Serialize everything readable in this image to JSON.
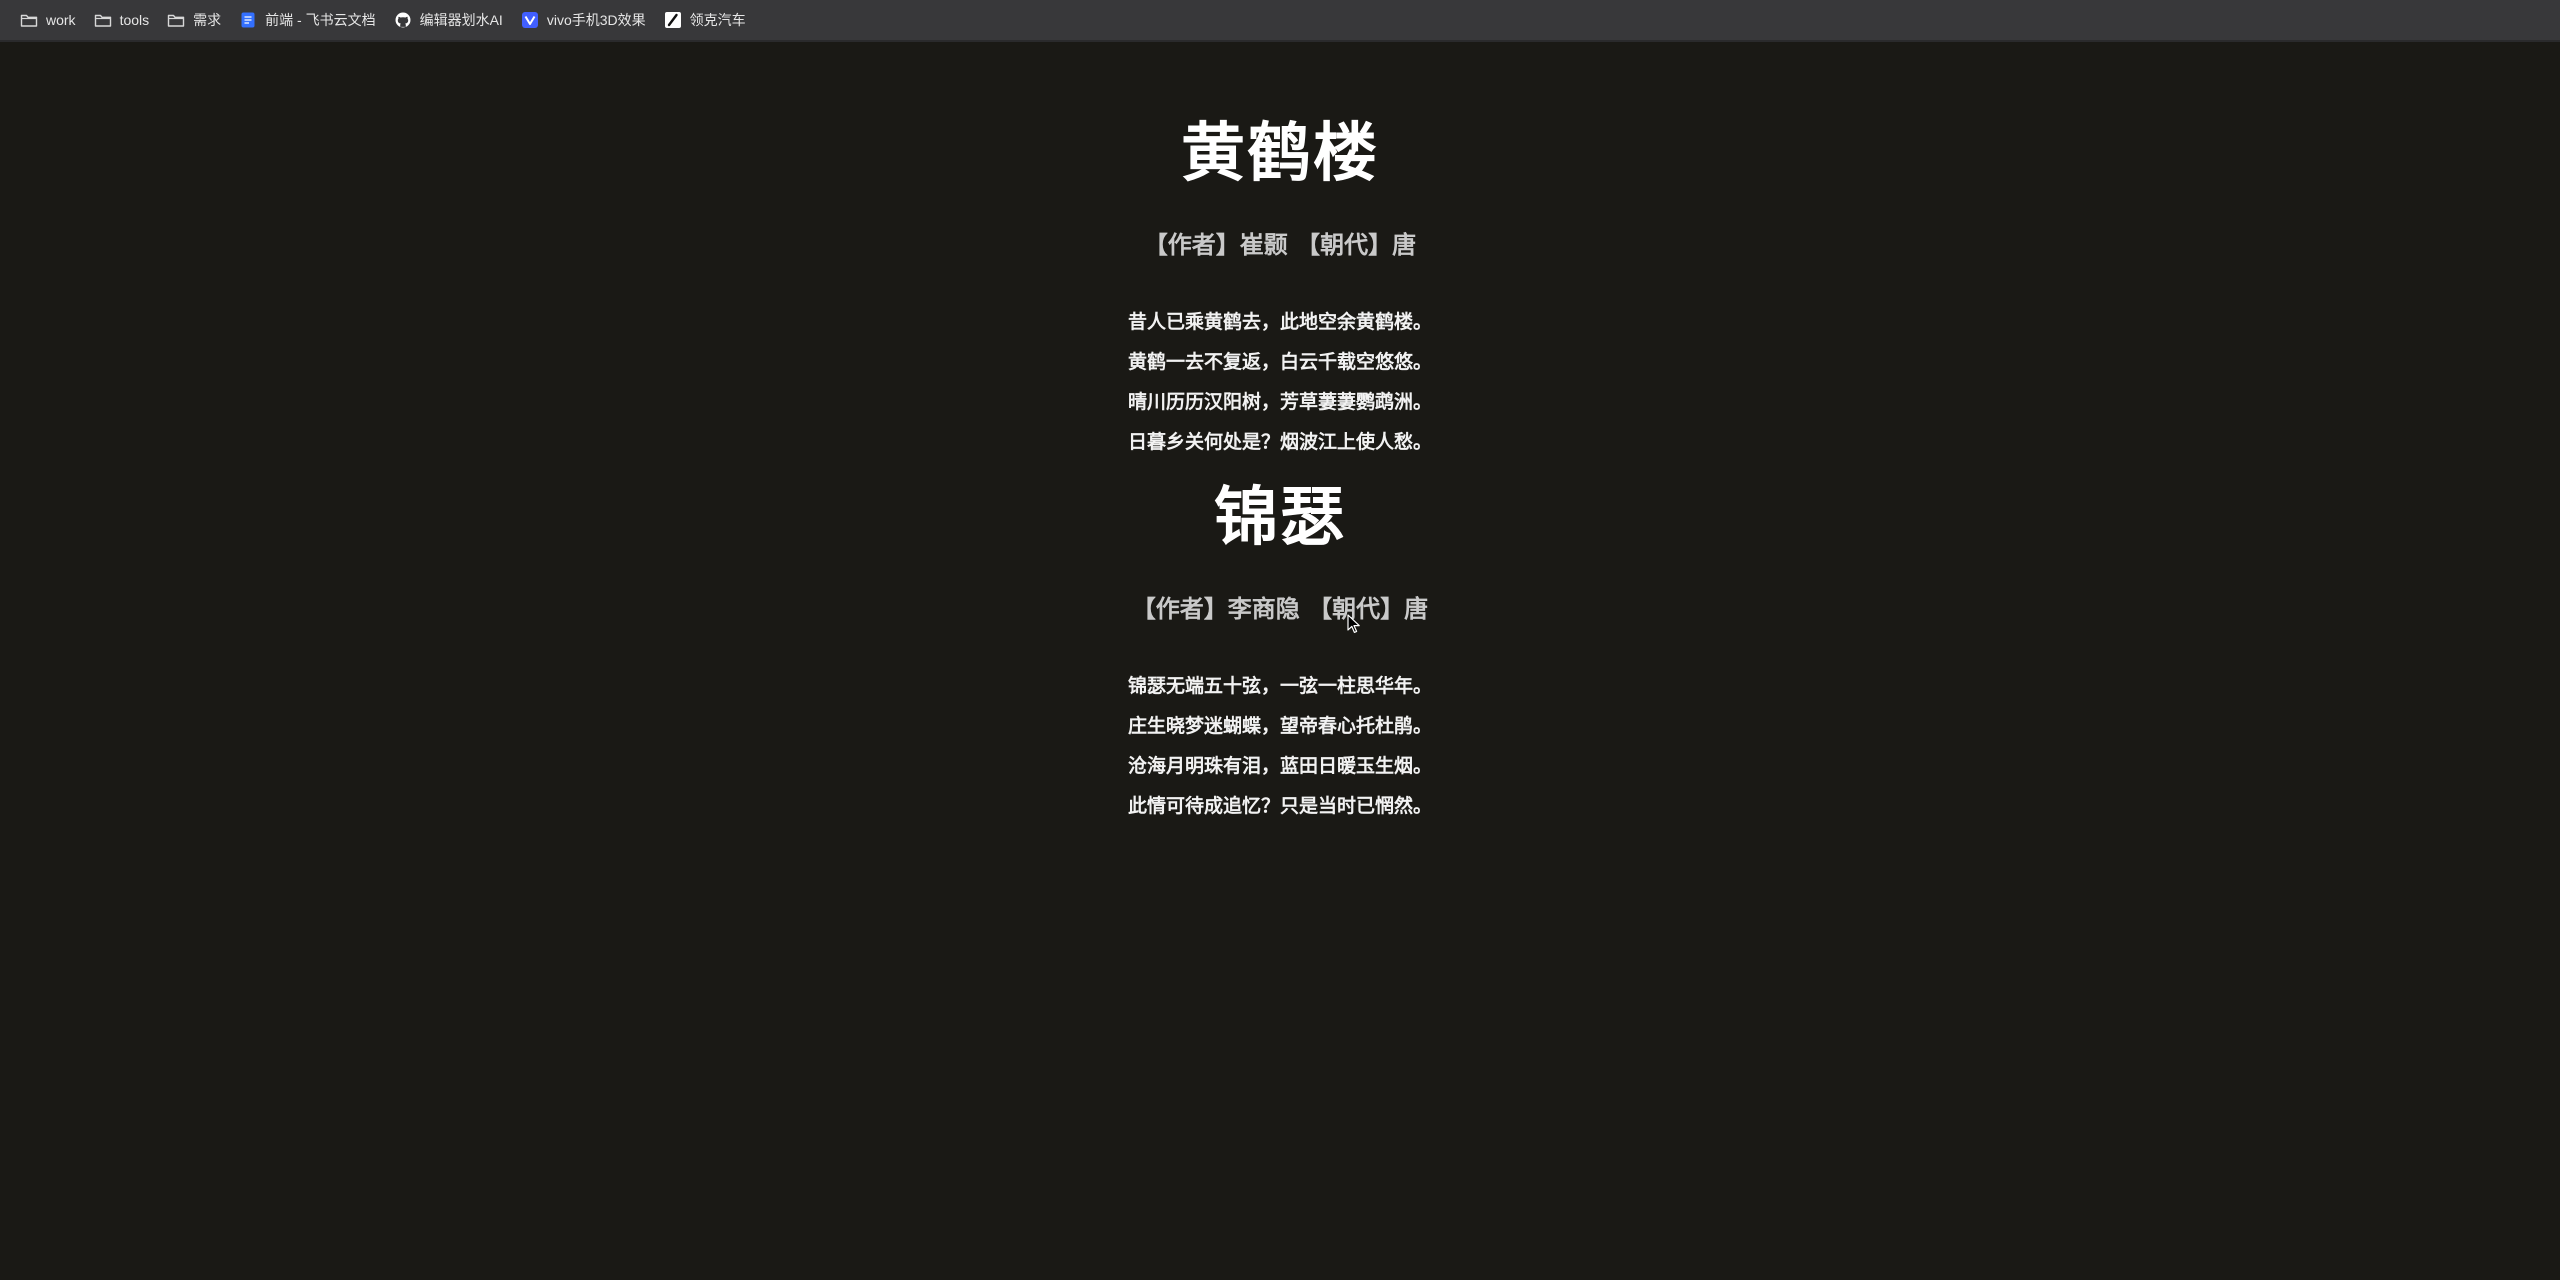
{
  "bookmarks": [
    {
      "label": "work",
      "icon": "folder-icon"
    },
    {
      "label": "tools",
      "icon": "folder-icon"
    },
    {
      "label": "需求",
      "icon": "folder-icon"
    },
    {
      "label": "前端 - 飞书云文档",
      "icon": "doc-icon"
    },
    {
      "label": "编辑器划水AI",
      "icon": "github-icon"
    },
    {
      "label": "vivo手机3D效果",
      "icon": "vivo-icon"
    },
    {
      "label": "领克汽车",
      "icon": "pen-icon"
    }
  ],
  "colors": {
    "background": "#1a1915",
    "bar": "#38383a",
    "text": "#ffffff",
    "meta": "#c9c9c9",
    "doc_blue": "#3370ff",
    "vivo_blue": "#415fff"
  },
  "poems": [
    {
      "title": "黄鹤楼",
      "meta": "【作者】崔颢 【朝代】唐",
      "lines": [
        "昔人已乘黄鹤去，此地空余黄鹤楼。",
        "黄鹤一去不复返，白云千载空悠悠。",
        "晴川历历汉阳树，芳草萋萋鹦鹉洲。",
        "日暮乡关何处是？烟波江上使人愁。"
      ]
    },
    {
      "title": "锦瑟",
      "meta": "【作者】李商隐 【朝代】唐",
      "lines": [
        "锦瑟无端五十弦，一弦一柱思华年。",
        "庄生晓梦迷蝴蝶，望帝春心托杜鹃。",
        "沧海月明珠有泪，蓝田日暖玉生烟。",
        "此情可待成追忆？只是当时已惘然。"
      ]
    }
  ]
}
